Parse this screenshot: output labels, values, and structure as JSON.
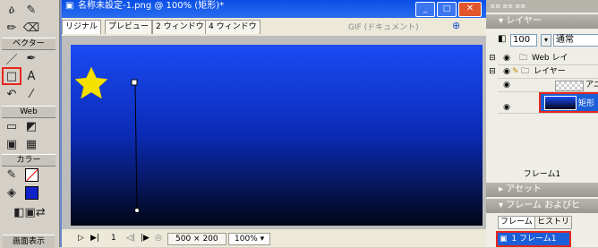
{
  "tools": {
    "section_vector": "ベクター",
    "section_web": "Web",
    "section_color": "カラー",
    "bottom_label": "画面表示"
  },
  "document": {
    "title": "名称未設定-1.png @ 100% (矩形)*",
    "tabs": [
      "リジナル",
      "プレビュー",
      "2 ウィンドウ",
      "4 ウィンドウ"
    ],
    "export_format": "GIF (ドキュメント)",
    "status": {
      "frame": "1",
      "size": "500 × 200",
      "zoom": "100%"
    }
  },
  "layers": {
    "panel_title": "レイヤー",
    "opacity": "100",
    "blend_mode": "通常",
    "rows": [
      {
        "name": "Web レイ"
      },
      {
        "name": "レイヤー"
      },
      {
        "name": "アニ"
      },
      {
        "name": "矩形"
      }
    ],
    "frame_label": "フレーム1",
    "assets_title": "アセット",
    "frames_title": "フレーム およびヒ",
    "frame_tabs": [
      "フレーム",
      "ヒストリ"
    ],
    "frame_item": "1 フレーム1"
  },
  "colors": {
    "highlight": "#e8261c",
    "star": "#f5e000",
    "canvas_top": "#1a4bf5",
    "canvas_bottom": "#020615"
  }
}
